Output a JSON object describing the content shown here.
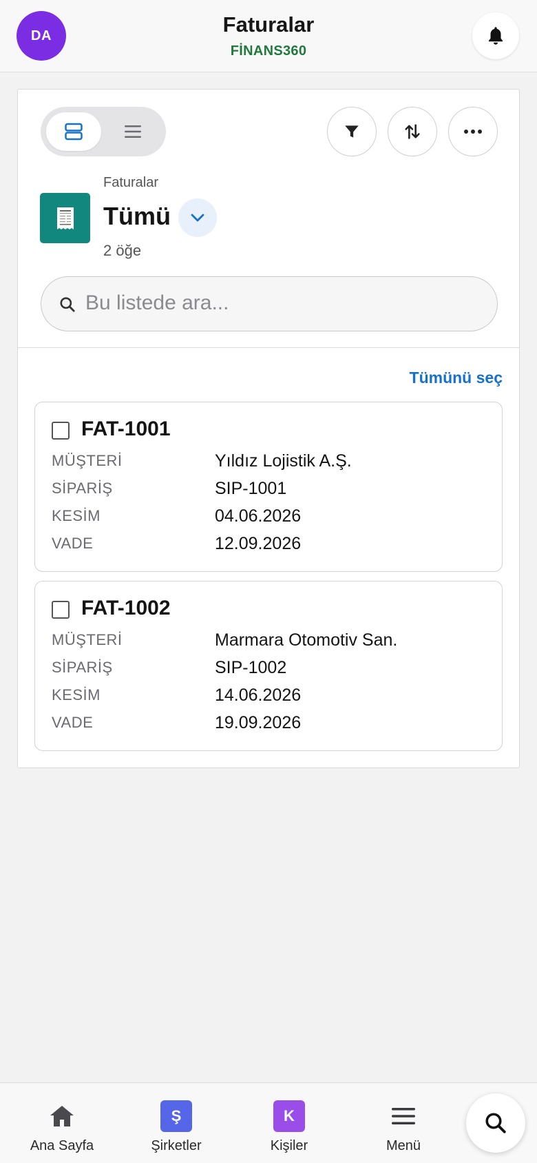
{
  "header": {
    "avatar_initials": "DA",
    "title": "Faturalar",
    "subtitle": "FİNANS360",
    "notification_icon": "bell-icon"
  },
  "toolbar": {
    "view_modes": [
      "card-view-icon",
      "list-view-icon"
    ],
    "active_view": "card-view-icon",
    "actions": [
      "filter-icon",
      "sort-icon",
      "more-icon"
    ]
  },
  "list": {
    "caption": "Faturalar",
    "name": "Tümü",
    "count": "2 öğe",
    "icon": "receipt-icon"
  },
  "search": {
    "placeholder": "Bu listede ara...",
    "value": ""
  },
  "select_all_label": "Tümünü seç",
  "invoices": [
    {
      "id": "FAT-1001",
      "fields": [
        {
          "label": "MÜŞTERİ",
          "value": "Yıldız Lojistik A.Ş."
        },
        {
          "label": "SİPARİŞ",
          "value": "SIP-1001"
        },
        {
          "label": "KESİM",
          "value": "04.06.2026"
        },
        {
          "label": "VADE",
          "value": "12.09.2026"
        }
      ]
    },
    {
      "id": "FAT-1002",
      "fields": [
        {
          "label": "MÜŞTERİ",
          "value": "Marmara Otomotiv San."
        },
        {
          "label": "SİPARİŞ",
          "value": "SIP-1002"
        },
        {
          "label": "KESİM",
          "value": "14.06.2026"
        },
        {
          "label": "VADE",
          "value": "19.09.2026"
        }
      ]
    }
  ],
  "bottom_nav": [
    {
      "label": "Ana Sayfa",
      "icon": "home-icon"
    },
    {
      "label": "Şirketler",
      "icon": "letter-tile",
      "letter": "Ş",
      "color": "#5566e8"
    },
    {
      "label": "Kişiler",
      "icon": "letter-tile",
      "letter": "K",
      "color": "#9a4de8"
    },
    {
      "label": "Menü",
      "icon": "hamburger-icon"
    }
  ],
  "colors": {
    "avatar": "#7a2de3",
    "brand_green": "#1f7a3c",
    "accent_blue": "#1672c8",
    "list_icon_bg": "#11877d"
  }
}
